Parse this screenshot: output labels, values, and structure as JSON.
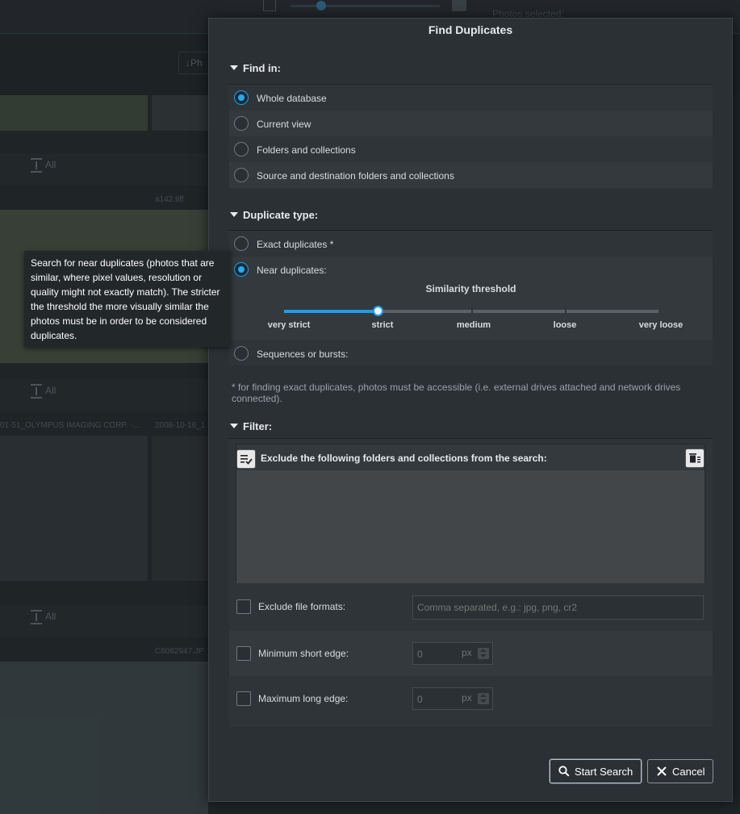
{
  "background": {
    "toolbar_button": "Ph",
    "all_label": "All",
    "file_names": [
      "a142.tiff",
      "01-51_OLYMPUS IMAGING CORP. -...",
      "2008-10-16_1",
      "C6062947.JP"
    ],
    "photos_selected": "Photos selected:"
  },
  "tooltip": {
    "text": "Search for near duplicates (photos that are similar, where pixel values, resolution or quality might not exactly match). The stricter the threshold the more visually similar the photos must be in order to be considered duplicates."
  },
  "dialog": {
    "title": "Find Duplicates",
    "find_in": {
      "heading": "Find in:",
      "options": [
        {
          "label": "Whole database",
          "selected": true
        },
        {
          "label": "Current view",
          "selected": false
        },
        {
          "label": "Folders and collections",
          "selected": false
        },
        {
          "label": "Source and destination folders and collections",
          "selected": false
        }
      ]
    },
    "duplicate_type": {
      "heading": "Duplicate type:",
      "options": [
        {
          "label": "Exact duplicates *",
          "selected": false
        },
        {
          "label": "Near duplicates:",
          "selected": true
        },
        {
          "label": "Sequences or bursts:",
          "selected": false
        }
      ],
      "similarity": {
        "title": "Similarity threshold",
        "levels": [
          "very strict",
          "strict",
          "medium",
          "loose",
          "very loose"
        ],
        "selected_index": 1
      }
    },
    "note": "* for finding exact duplicates, photos must be accessible (i.e. external drives attached and network drives connected).",
    "filter": {
      "heading": "Filter:",
      "exclude_title": "Exclude the following folders and collections from the search:",
      "exclude_formats": {
        "label": "Exclude file formats:",
        "placeholder": "Comma separated, e.g.: jpg, png, cr2",
        "checked": false
      },
      "min_short_edge": {
        "label": "Minimum short edge:",
        "value": "0",
        "unit": "px",
        "checked": false
      },
      "max_long_edge": {
        "label": "Maximum long edge:",
        "value": "0",
        "unit": "px",
        "checked": false
      }
    },
    "buttons": {
      "start_search": "Start Search",
      "cancel": "Cancel"
    }
  },
  "colors": {
    "accent": "#1e9de6",
    "dialog_bg": "#2b3034",
    "tooltip_bg": "#22272a"
  }
}
